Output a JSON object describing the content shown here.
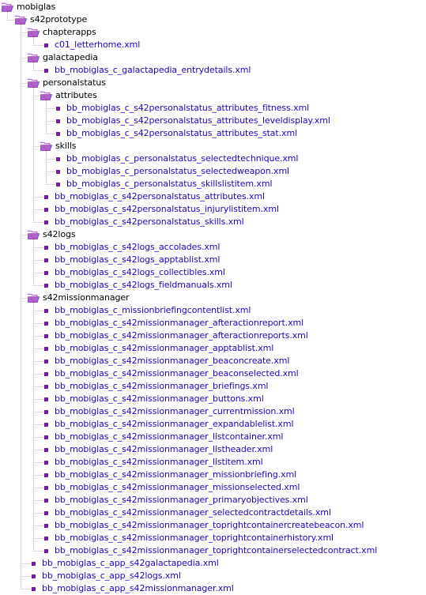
{
  "icons": {
    "folder": "folder-open-icon",
    "file": "file-bullet-icon",
    "folder_color": "#b05fd0",
    "bullet_color": "#7a1ea1",
    "guide_color": "#b9b9b9"
  },
  "tree": [
    {
      "depth": 0,
      "type": "folder",
      "label": "mobiglas"
    },
    {
      "depth": 1,
      "type": "folder",
      "label": "s42prototype"
    },
    {
      "depth": 2,
      "type": "folder",
      "label": "chapterapps"
    },
    {
      "depth": 3,
      "type": "file",
      "label": "c01_letterhome.xml"
    },
    {
      "depth": 2,
      "type": "folder",
      "label": "galactapedia"
    },
    {
      "depth": 3,
      "type": "file",
      "label": "bb_mobiglas_c_galactapedia_entrydetails.xml"
    },
    {
      "depth": 2,
      "type": "folder",
      "label": "personalstatus"
    },
    {
      "depth": 3,
      "type": "folder",
      "label": "attributes"
    },
    {
      "depth": 4,
      "type": "file",
      "label": "bb_mobiglas_c_s42personalstatus_attributes_fitness.xml"
    },
    {
      "depth": 4,
      "type": "file",
      "label": "bb_mobiglas_c_s42personalstatus_attributes_leveldisplay.xml"
    },
    {
      "depth": 4,
      "type": "file",
      "label": "bb_mobiglas_c_s42personalstatus_attributes_stat.xml"
    },
    {
      "depth": 3,
      "type": "folder",
      "label": "skills"
    },
    {
      "depth": 4,
      "type": "file",
      "label": "bb_mobiglas_c_personalstatus_selectedtechnique.xml"
    },
    {
      "depth": 4,
      "type": "file",
      "label": "bb_mobiglas_c_personalstatus_selectedweapon.xml"
    },
    {
      "depth": 4,
      "type": "file",
      "label": "bb_mobiglas_c_personalstatus_skillslistitem.xml"
    },
    {
      "depth": 3,
      "type": "file",
      "label": "bb_mobiglas_c_s42personalstatus_attributes.xml"
    },
    {
      "depth": 3,
      "type": "file",
      "label": "bb_mobiglas_c_s42personalstatus_injurylistitem.xml"
    },
    {
      "depth": 3,
      "type": "file",
      "label": "bb_mobiglas_c_s42personalstatus_skills.xml"
    },
    {
      "depth": 2,
      "type": "folder",
      "label": "s42logs"
    },
    {
      "depth": 3,
      "type": "file",
      "label": "bb_mobiglas_c_s42logs_accolades.xml"
    },
    {
      "depth": 3,
      "type": "file",
      "label": "bb_mobiglas_c_s42logs_apptablist.xml"
    },
    {
      "depth": 3,
      "type": "file",
      "label": "bb_mobiglas_c_s42logs_collectibles.xml"
    },
    {
      "depth": 3,
      "type": "file",
      "label": "bb_mobiglas_c_s42logs_fieldmanuals.xml"
    },
    {
      "depth": 2,
      "type": "folder",
      "label": "s42missionmanager"
    },
    {
      "depth": 3,
      "type": "file",
      "label": "bb_mobiglas_c_missionbriefingcontentlist.xml"
    },
    {
      "depth": 3,
      "type": "file",
      "label": "bb_mobiglas_c_s42missionmanager_afteractionreport.xml"
    },
    {
      "depth": 3,
      "type": "file",
      "label": "bb_mobiglas_c_s42missionmanager_afteractionreports.xml"
    },
    {
      "depth": 3,
      "type": "file",
      "label": "bb_mobiglas_c_s42missionmanager_apptablist.xml"
    },
    {
      "depth": 3,
      "type": "file",
      "label": "bb_mobiglas_c_s42missionmanager_beaconcreate.xml"
    },
    {
      "depth": 3,
      "type": "file",
      "label": "bb_mobiglas_c_s42missionmanager_beaconselected.xml"
    },
    {
      "depth": 3,
      "type": "file",
      "label": "bb_mobiglas_c_s42missionmanager_briefings.xml"
    },
    {
      "depth": 3,
      "type": "file",
      "label": "bb_mobiglas_c_s42missionmanager_buttons.xml"
    },
    {
      "depth": 3,
      "type": "file",
      "label": "bb_mobiglas_c_s42missionmanager_currentmission.xml"
    },
    {
      "depth": 3,
      "type": "file",
      "label": "bb_mobiglas_c_s42missionmanager_expandablelist.xml"
    },
    {
      "depth": 3,
      "type": "file",
      "label": "bb_mobiglas_c_s42missionmanager_listcontainer.xml"
    },
    {
      "depth": 3,
      "type": "file",
      "label": "bb_mobiglas_c_s42missionmanager_listheader.xml"
    },
    {
      "depth": 3,
      "type": "file",
      "label": "bb_mobiglas_c_s42missionmanager_listitem.xml"
    },
    {
      "depth": 3,
      "type": "file",
      "label": "bb_mobiglas_c_s42missionmanager_missionbriefing.xml"
    },
    {
      "depth": 3,
      "type": "file",
      "label": "bb_mobiglas_c_s42missionmanager_missionselected.xml"
    },
    {
      "depth": 3,
      "type": "file",
      "label": "bb_mobiglas_c_s42missionmanager_primaryobjectives.xml"
    },
    {
      "depth": 3,
      "type": "file",
      "label": "bb_mobiglas_c_s42missionmanager_selectedcontractdetails.xml"
    },
    {
      "depth": 3,
      "type": "file",
      "label": "bb_mobiglas_c_s42missionmanager_toprightcontainercreatebeacon.xml"
    },
    {
      "depth": 3,
      "type": "file",
      "label": "bb_mobiglas_c_s42missionmanager_toprightcontainerhistory.xml"
    },
    {
      "depth": 3,
      "type": "file",
      "label": "bb_mobiglas_c_s42missionmanager_toprightcontainerselectedcontract.xml"
    },
    {
      "depth": 2,
      "type": "file",
      "label": "bb_mobiglas_c_app_s42galactapedia.xml"
    },
    {
      "depth": 2,
      "type": "file",
      "label": "bb_mobiglas_c_app_s42logs.xml"
    },
    {
      "depth": 2,
      "type": "file",
      "label": "bb_mobiglas_c_app_s42missionmanager.xml"
    }
  ]
}
